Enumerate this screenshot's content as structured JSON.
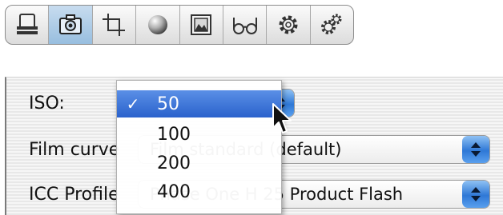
{
  "toolbar": {
    "buttons": [
      {
        "icon": "stack-icon",
        "selected": false
      },
      {
        "icon": "camera-icon",
        "selected": true
      },
      {
        "icon": "crop-icon",
        "selected": false
      },
      {
        "icon": "sphere-icon",
        "selected": false
      },
      {
        "icon": "picture-icon",
        "selected": false
      },
      {
        "icon": "glasses-icon",
        "selected": false
      },
      {
        "icon": "gear-icon",
        "selected": false
      },
      {
        "icon": "gears-icon",
        "selected": false
      }
    ]
  },
  "panel": {
    "iso_label": "ISO:",
    "film_curve_label": "Film curve",
    "film_curve_value": "Film standard (default)",
    "icc_label": "ICC Profile",
    "icc_value": "Phase One H 25 Product Flash"
  },
  "iso_menu": {
    "check_mark": "✓",
    "options": [
      "50",
      "100",
      "200",
      "400"
    ],
    "selected": "50"
  },
  "colors": {
    "selection": "#2a62cc",
    "toolbar_selected": "#98bedf",
    "popup_arrows": "#2f78d6"
  }
}
